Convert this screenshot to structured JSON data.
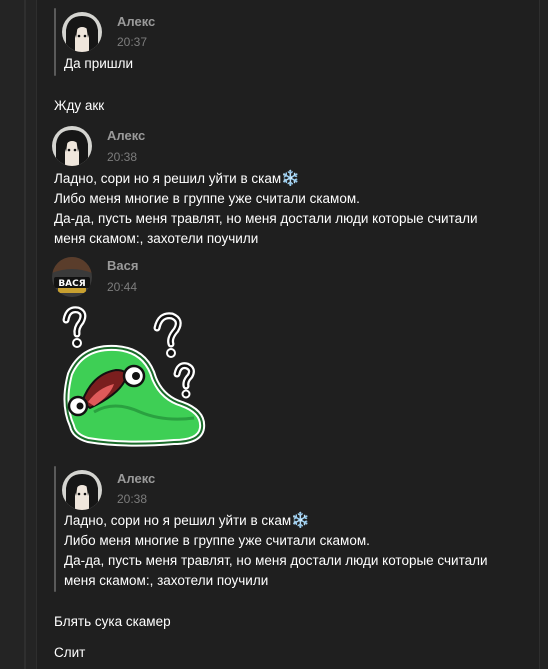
{
  "messages": [
    {
      "type": "quote",
      "author": "Алекс",
      "time": "20:37",
      "lines": [
        "Да пришли"
      ]
    },
    {
      "type": "text",
      "lines": [
        "Жду акк"
      ]
    },
    {
      "type": "message",
      "author": "Алекс",
      "time": "20:38",
      "lines": [
        "Ладно, сори но я решил уйти в скам",
        "Либо меня многие в группе уже считали скамом.",
        "Да-да, пусть меня травлят, но меня достали люди которые считали",
        "меня скамом:, захотели поучили"
      ]
    },
    {
      "type": "message",
      "author": "Вася",
      "time": "20:44",
      "avatar_text": "ВАСЯ",
      "sticker": "green-frog-confused-sticker"
    },
    {
      "type": "quote",
      "author": "Алекс",
      "time": "20:38",
      "lines": [
        "Ладно, сори но я решил уйти в скам",
        "Либо меня многие в группе уже считали скамом.",
        "Да-да, пусть меня травлят, но меня достали люди которые считали",
        "меня скамом:, захотели поучили"
      ]
    },
    {
      "type": "text",
      "lines": [
        "Блять сука скамер"
      ]
    },
    {
      "type": "text",
      "lines": [
        "Слит"
      ]
    }
  ],
  "emoji": {
    "snowflake": "❄️"
  },
  "colors": {
    "background": "#1f1f1f",
    "author": "#9a9a9a",
    "timestamp": "#7c7c7c",
    "quote_bar": "#5a5a5a",
    "sticker_green": "#3ecf55"
  }
}
